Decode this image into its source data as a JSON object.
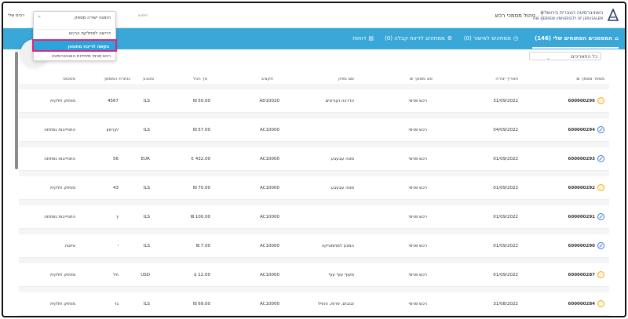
{
  "header": {
    "university_he": "האוניברסיטה העברית בירושלים",
    "university_en": "THE HEBREW UNIVERSITY OF JERUSALEM",
    "app_title": "ניהול מסמכי רכש",
    "search_hint": "חיפוש",
    "user": "רבים שלי"
  },
  "tabs": [
    {
      "label": "(146) המסמכים הפתוחים שלי",
      "icon": "home-icon"
    },
    {
      "label": "(0) ממתינים לאישור",
      "icon": "clock-icon"
    },
    {
      "label": "(0) ממתינים לדיווח קבלה",
      "icon": "gear-icon"
    },
    {
      "label": "דוחות",
      "icon": "report-icon"
    }
  ],
  "filter": {
    "value": "כל התאריכים"
  },
  "columns": {
    "doc_number": "מספר מסמך",
    "created": "תאריך יצירה",
    "doc_type": "סוג מסמך",
    "vendor": "שם ספק",
    "budget": "תקציב",
    "total": "סך הכל",
    "currency": "מטבע",
    "title": "כותרת המסמך",
    "status": "סטטוס"
  },
  "rows": [
    {
      "id": "600000296",
      "icon": "yellow",
      "date": "31/09/2022",
      "type": "רכש פנימי",
      "vendor": "הדרכה וקורסים",
      "budget": "AD10020",
      "total": "₪ 50.00",
      "cur": "ILS",
      "title": "4567",
      "status": "מוחזק חלקית"
    },
    {
      "id": "600000294",
      "icon": "blue",
      "date": "04/09/2022",
      "type": "רכש פנימי",
      "vendor": "",
      "budget": "AC10000",
      "total": "₪ 57.00",
      "cur": "ILS",
      "title": "קרטון/",
      "status": "התחייבות נפתחה"
    },
    {
      "id": "600000293",
      "icon": "blue",
      "date": "01/09/2022",
      "type": "רכש פנימי",
      "vendor": "מטה עבעבע",
      "budget": "AC10000",
      "total": "€ 432.00",
      "cur": "EUR",
      "title": "56",
      "status": "התחייבות נפתחה"
    },
    {
      "id": "600000292",
      "icon": "yellow",
      "date": "01/09/2022",
      "type": "רכש פנימי",
      "vendor": "מטה עבעבע",
      "budget": "AC10000",
      "total": "₪ 70.00",
      "cur": "ILS",
      "title": "43",
      "status": "מוחזק חלקית"
    },
    {
      "id": "600000291",
      "icon": "blue",
      "date": "01/09/2022",
      "type": "רכש פנימי",
      "vendor": "",
      "budget": "AC10000",
      "total": "₪ 100.00",
      "cur": "ILS",
      "title": "ץ",
      "status": "התחייבות נפתחה"
    },
    {
      "id": "600000290",
      "icon": "blue",
      "date": "01/09/2022",
      "type": "רכש פנימי",
      "vendor": "המכון למתמטיקה",
      "budget": "AC10000",
      "total": "₪ 7.00",
      "cur": "ILS",
      "title": "י",
      "status": "טיוטה"
    },
    {
      "id": "600000287",
      "icon": "yellow",
      "date": "01/09/2022",
      "type": "רכש פנימי",
      "vendor": "מעוף עוף עוף",
      "budget": "AC10000",
      "total": "$ 12.00",
      "cur": "USD",
      "title": "חל",
      "status": "מוחזק חלקית"
    },
    {
      "id": "600000284",
      "icon": "yellow",
      "date": "31/08/2022",
      "type": "רכש פנימי",
      "vendor": "זבובים, פרות, והפיל",
      "budget": "AC10000",
      "total": "₪ 69.00",
      "cur": "ILS",
      "title": "גד",
      "status": "מוחזק חלקית"
    }
  ],
  "menu": {
    "items": [
      "הזמנה ישירה מספק",
      "דרישה למחלקת הרכש",
      "בקשה לריכוז מחנהון",
      "רכש פנימי מיחידות האוניברסיטה"
    ]
  }
}
